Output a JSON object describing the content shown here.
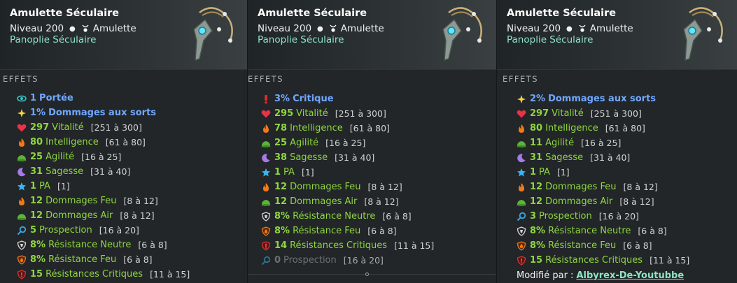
{
  "cards": [
    {
      "title": "Amulette Séculaire",
      "level": "Niveau 200",
      "type": "Amulette",
      "set": "Panoplie Séculaire",
      "effects_header": "EFFETS",
      "effects": [
        {
          "icon": "eye-icon",
          "value": "1",
          "label": "Portée",
          "range": "",
          "style": "blue"
        },
        {
          "icon": "sparkle-icon",
          "value": "1%",
          "label": "Dommages aux sorts",
          "range": "",
          "style": "blue"
        },
        {
          "icon": "heart-icon",
          "value": "297",
          "label": "Vitalité",
          "range": "[251 à 300]",
          "style": "green"
        },
        {
          "icon": "fire-icon",
          "value": "80",
          "label": "Intelligence",
          "range": "[61 à 80]",
          "style": "green"
        },
        {
          "icon": "agility-icon",
          "value": "25",
          "label": "Agilité",
          "range": "[16 à 25]",
          "style": "green"
        },
        {
          "icon": "moon-icon",
          "value": "31",
          "label": "Sagesse",
          "range": "[31 à 40]",
          "style": "green"
        },
        {
          "icon": "star-icon",
          "value": "1",
          "label": "PA",
          "range": "[1]",
          "style": "green"
        },
        {
          "icon": "fire-icon",
          "value": "12",
          "label": "Dommages Feu",
          "range": "[8 à 12]",
          "style": "green"
        },
        {
          "icon": "agility-icon",
          "value": "12",
          "label": "Dommages Air",
          "range": "[8 à 12]",
          "style": "green"
        },
        {
          "icon": "magnifier-icon",
          "value": "5",
          "label": "Prospection",
          "range": "[16 à 20]",
          "style": "green"
        },
        {
          "icon": "shield-neutral-icon",
          "value": "8%",
          "label": "Résistance Neutre",
          "range": "[6 à 8]",
          "style": "green"
        },
        {
          "icon": "shield-fire-icon",
          "value": "8%",
          "label": "Résistance Feu",
          "range": "[6 à 8]",
          "style": "green"
        },
        {
          "icon": "shield-crit-icon",
          "value": "15",
          "label": "Résistances Critiques",
          "range": "[11 à 15]",
          "style": "green"
        }
      ]
    },
    {
      "title": "Amulette Séculaire",
      "level": "Niveau 200",
      "type": "Amulette",
      "set": "Panoplie Séculaire",
      "effects_header": "EFFETS",
      "effects": [
        {
          "icon": "exclamation-icon",
          "value": "3%",
          "label": "Critique",
          "range": "",
          "style": "blue"
        },
        {
          "icon": "heart-icon",
          "value": "295",
          "label": "Vitalité",
          "range": "[251 à 300]",
          "style": "green"
        },
        {
          "icon": "fire-icon",
          "value": "78",
          "label": "Intelligence",
          "range": "[61 à 80]",
          "style": "green"
        },
        {
          "icon": "agility-icon",
          "value": "25",
          "label": "Agilité",
          "range": "[16 à 25]",
          "style": "green"
        },
        {
          "icon": "moon-icon",
          "value": "38",
          "label": "Sagesse",
          "range": "[31 à 40]",
          "style": "green"
        },
        {
          "icon": "star-icon",
          "value": "1",
          "label": "PA",
          "range": "[1]",
          "style": "green"
        },
        {
          "icon": "fire-icon",
          "value": "12",
          "label": "Dommages Feu",
          "range": "[8 à 12]",
          "style": "green"
        },
        {
          "icon": "agility-icon",
          "value": "12",
          "label": "Dommages Air",
          "range": "[8 à 12]",
          "style": "green"
        },
        {
          "icon": "shield-neutral-icon",
          "value": "8%",
          "label": "Résistance Neutre",
          "range": "[6 à 8]",
          "style": "green"
        },
        {
          "icon": "shield-fire-icon",
          "value": "8%",
          "label": "Résistance Feu",
          "range": "[6 à 8]",
          "style": "green"
        },
        {
          "icon": "shield-crit-icon",
          "value": "14",
          "label": "Résistances Critiques",
          "range": "[11 à 15]",
          "style": "green"
        },
        {
          "icon": "magnifier-icon",
          "value": "0",
          "label": "Prospection",
          "range": "[16 à 20]",
          "style": "grey"
        }
      ]
    },
    {
      "title": "Amulette Séculaire",
      "level": "Niveau 200",
      "type": "Amulette",
      "set": "Panoplie Séculaire",
      "effects_header": "EFFETS",
      "effects": [
        {
          "icon": "sparkle-icon",
          "value": "2%",
          "label": "Dommages aux sorts",
          "range": "",
          "style": "blue"
        },
        {
          "icon": "heart-icon",
          "value": "297",
          "label": "Vitalité",
          "range": "[251 à 300]",
          "style": "green"
        },
        {
          "icon": "fire-icon",
          "value": "80",
          "label": "Intelligence",
          "range": "[61 à 80]",
          "style": "green"
        },
        {
          "icon": "agility-icon",
          "value": "11",
          "label": "Agilité",
          "range": "[16 à 25]",
          "style": "green"
        },
        {
          "icon": "moon-icon",
          "value": "31",
          "label": "Sagesse",
          "range": "[31 à 40]",
          "style": "green"
        },
        {
          "icon": "star-icon",
          "value": "1",
          "label": "PA",
          "range": "[1]",
          "style": "green"
        },
        {
          "icon": "fire-icon",
          "value": "12",
          "label": "Dommages Feu",
          "range": "[8 à 12]",
          "style": "green"
        },
        {
          "icon": "agility-icon",
          "value": "12",
          "label": "Dommages Air",
          "range": "[8 à 12]",
          "style": "green"
        },
        {
          "icon": "magnifier-icon",
          "value": "3",
          "label": "Prospection",
          "range": "[16 à 20]",
          "style": "green"
        },
        {
          "icon": "shield-neutral-icon",
          "value": "8%",
          "label": "Résistance Neutre",
          "range": "[6 à 8]",
          "style": "green"
        },
        {
          "icon": "shield-fire-icon",
          "value": "8%",
          "label": "Résistance Feu",
          "range": "[6 à 8]",
          "style": "green"
        },
        {
          "icon": "shield-crit-icon",
          "value": "15",
          "label": "Résistances Critiques",
          "range": "[11 à 15]",
          "style": "green"
        }
      ],
      "modified_by_label": "Modifié par :",
      "modified_by_name": "Albyrex-De-Youtubbe"
    }
  ],
  "colors": {
    "green": "#8fd63f",
    "blue": "#6fa8ff",
    "grey": "#6b7275",
    "set": "#8fe3c4"
  }
}
